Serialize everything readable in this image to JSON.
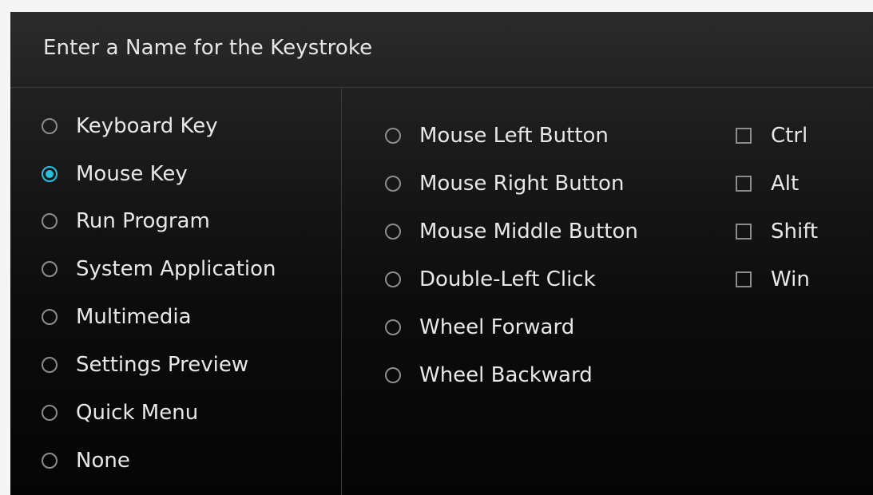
{
  "dialog": {
    "title": "Enter a Name for the Keystroke"
  },
  "action_types": [
    {
      "label": "Keyboard Key",
      "selected": false
    },
    {
      "label": "Mouse Key",
      "selected": true
    },
    {
      "label": "Run Program",
      "selected": false
    },
    {
      "label": "System Application",
      "selected": false
    },
    {
      "label": "Multimedia",
      "selected": false
    },
    {
      "label": "Settings Preview",
      "selected": false
    },
    {
      "label": "Quick Menu",
      "selected": false
    },
    {
      "label": "None",
      "selected": false
    }
  ],
  "mouse_buttons": [
    {
      "label": "Mouse Left Button",
      "selected": false
    },
    {
      "label": "Mouse Right Button",
      "selected": false
    },
    {
      "label": "Mouse Middle Button",
      "selected": false
    },
    {
      "label": "Double-Left Click",
      "selected": false
    },
    {
      "label": "Wheel Forward",
      "selected": false
    },
    {
      "label": "Wheel Backward",
      "selected": false
    }
  ],
  "modifiers": [
    {
      "label": "Ctrl",
      "checked": false
    },
    {
      "label": "Alt",
      "checked": false
    },
    {
      "label": "Shift",
      "checked": false
    },
    {
      "label": "Win",
      "checked": false
    }
  ],
  "colors": {
    "accent": "#29c0e0",
    "text": "#e8e8e8",
    "control_border": "#8c8c8c"
  }
}
